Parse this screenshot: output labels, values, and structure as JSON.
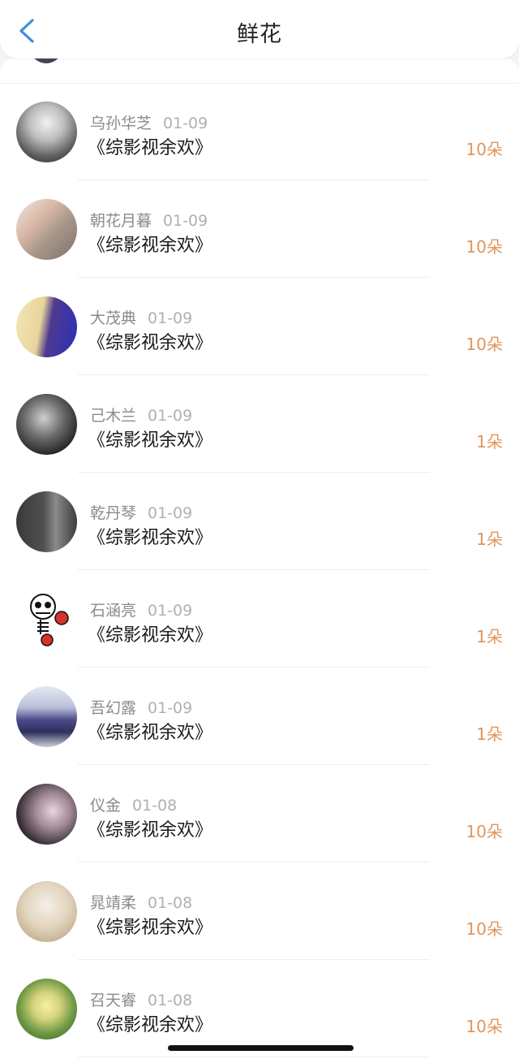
{
  "header": {
    "title": "鲜花"
  },
  "items": [
    {
      "name": "乌孙华芝",
      "date": "01-09",
      "book": "《综影视余欢》",
      "amount": "10朵"
    },
    {
      "name": "朝花月暮",
      "date": "01-09",
      "book": "《综影视余欢》",
      "amount": "10朵"
    },
    {
      "name": "大茂典",
      "date": "01-09",
      "book": "《综影视余欢》",
      "amount": "10朵"
    },
    {
      "name": "己木兰",
      "date": "01-09",
      "book": "《综影视余欢》",
      "amount": "1朵"
    },
    {
      "name": "乾丹琴",
      "date": "01-09",
      "book": "《综影视余欢》",
      "amount": "1朵"
    },
    {
      "name": "石涵亮",
      "date": "01-09",
      "book": "《综影视余欢》",
      "amount": "1朵"
    },
    {
      "name": "吾幻露",
      "date": "01-09",
      "book": "《综影视余欢》",
      "amount": "1朵"
    },
    {
      "name": "仪金",
      "date": "01-08",
      "book": "《综影视余欢》",
      "amount": "10朵"
    },
    {
      "name": "晁靖柔",
      "date": "01-08",
      "book": "《综影视余欢》",
      "amount": "10朵"
    },
    {
      "name": "召天睿",
      "date": "01-08",
      "book": "《综影视余欢》",
      "amount": "10朵"
    }
  ],
  "colors": {
    "accent": "#e2955a",
    "back_icon": "#3f8cdc",
    "divider": "#eceef1"
  }
}
